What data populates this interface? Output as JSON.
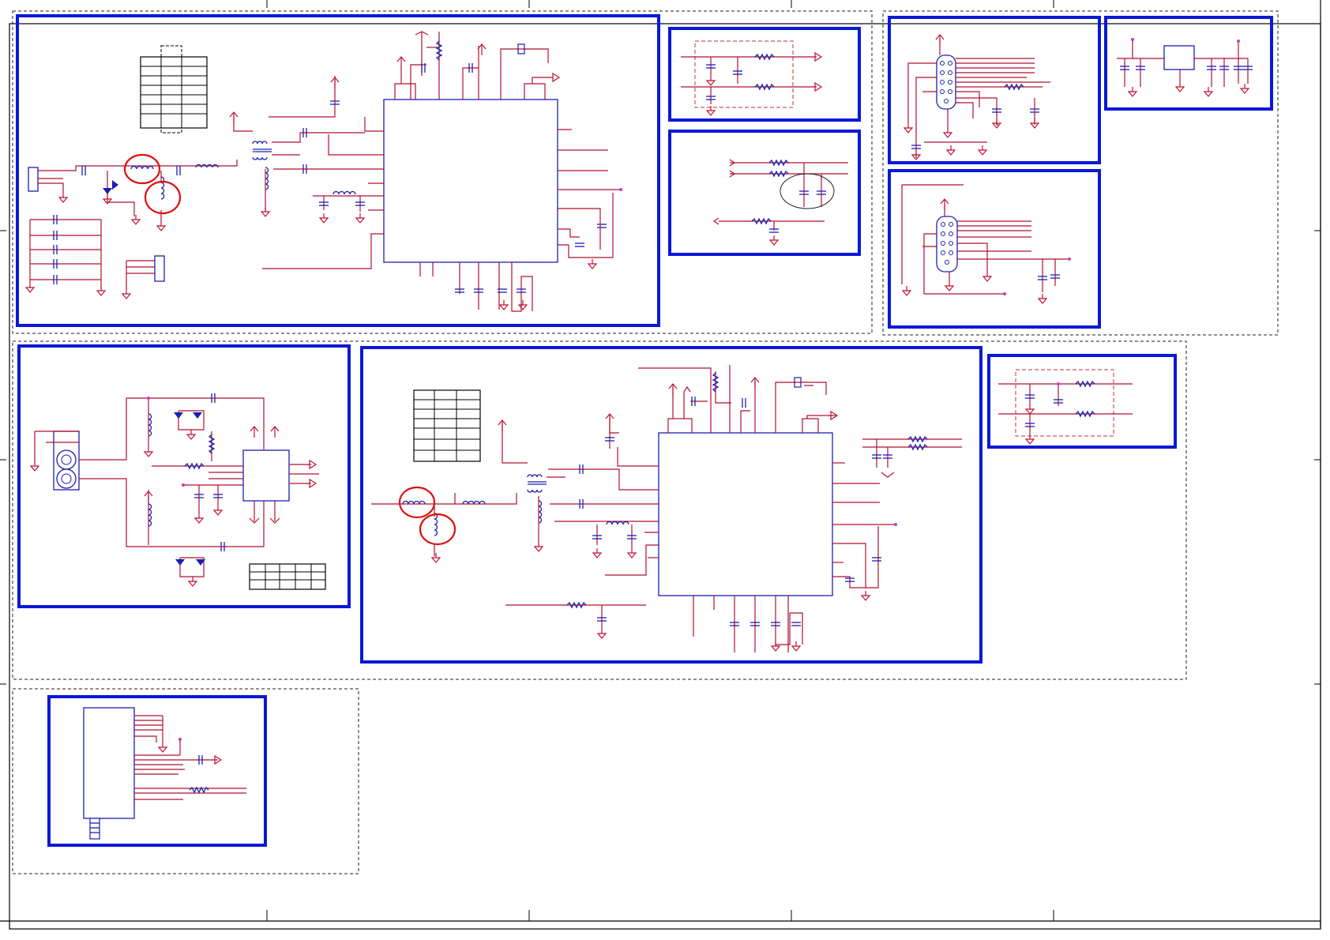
{
  "sheet": {
    "title": "",
    "colors": {
      "block_border": "#0a18d8",
      "wire": "#b0102e",
      "component": "#1a20b0",
      "highlight": "#dd1111",
      "frame": "#000000"
    },
    "icons": [
      "resistor-icon",
      "inductor-icon",
      "capacitor-icon",
      "ground-icon",
      "transformer-icon",
      "crystal-icon",
      "diode-icon",
      "connector-icon",
      "db-connector-icon"
    ]
  },
  "blocks": [
    {
      "id": "tuner-top",
      "kind": "ic-with-rf-frontend"
    },
    {
      "id": "filter-top",
      "kind": "rc-filter"
    },
    {
      "id": "filter-mid",
      "kind": "rc-filter"
    },
    {
      "id": "vga-connector-1",
      "kind": "db15-connector"
    },
    {
      "id": "regulator",
      "kind": "voltage-regulator"
    },
    {
      "id": "vga-connector-2",
      "kind": "db15-connector"
    },
    {
      "id": "audio-jack",
      "kind": "rca-jack-with-switch"
    },
    {
      "id": "tuner-bottom",
      "kind": "ic-with-rf-frontend"
    },
    {
      "id": "filter-right",
      "kind": "rc-filter"
    },
    {
      "id": "header-module",
      "kind": "connector-module"
    }
  ],
  "highlights": [
    {
      "id": "inductor-circle-1"
    },
    {
      "id": "inductor-circle-2"
    },
    {
      "id": "inductor-circle-3"
    },
    {
      "id": "inductor-circle-4"
    }
  ]
}
